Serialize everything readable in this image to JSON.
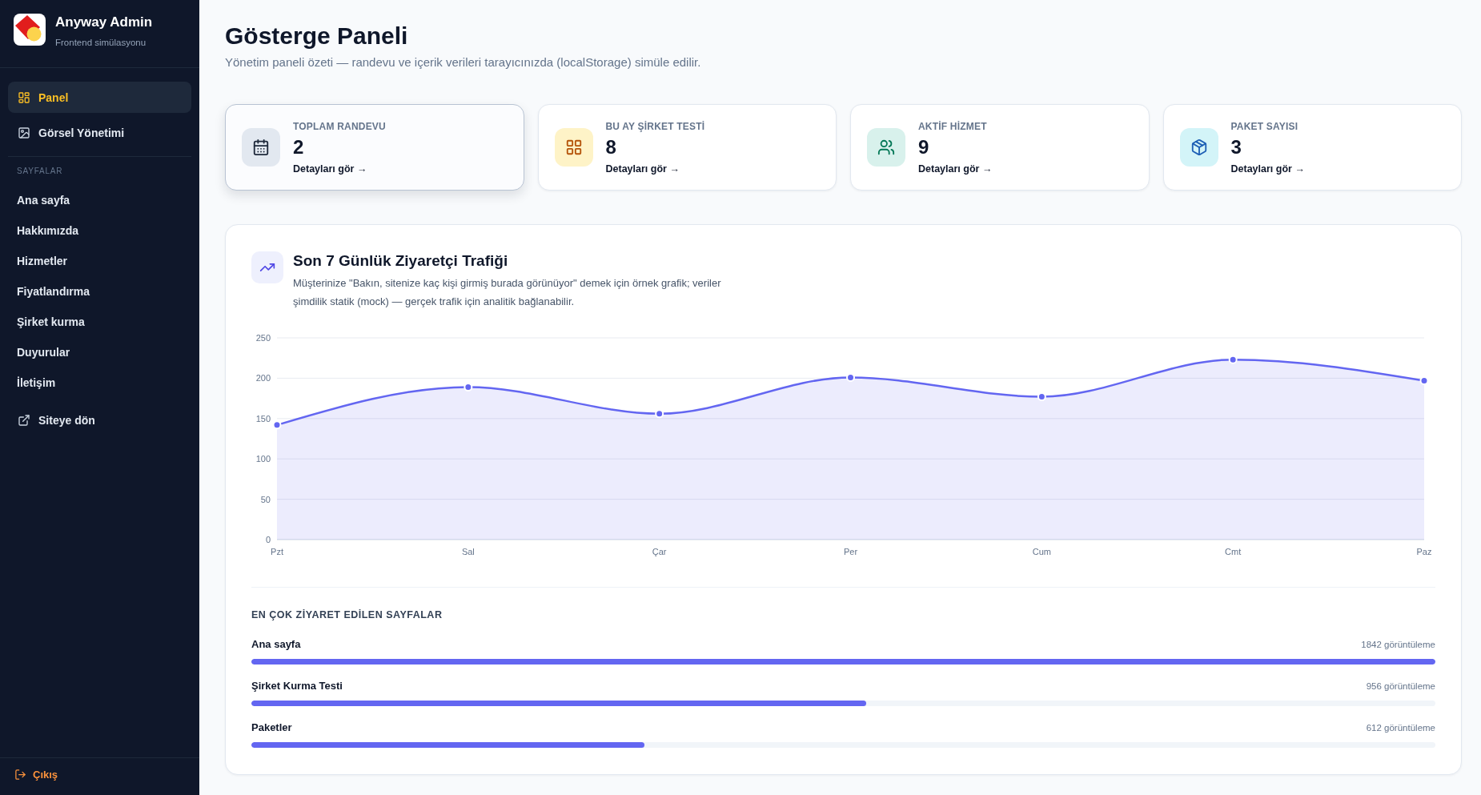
{
  "sidebar": {
    "brand": {
      "title": "Anyway Admin",
      "subtitle": "Frontend simülasyonu"
    },
    "main_items": [
      {
        "label": "Panel",
        "selected": true
      },
      {
        "label": "Görsel Yönetimi",
        "selected": false
      }
    ],
    "section": {
      "title": "SAYFALAR",
      "items": [
        {
          "label": "Ana sayfa",
          "selected": false
        },
        {
          "label": "Hakkımızda",
          "selected": false
        },
        {
          "label": "Hizmetler",
          "selected": false
        },
        {
          "label": "Fiyatlandırma",
          "selected": false
        },
        {
          "label": "Şirket kurma",
          "selected": false
        },
        {
          "label": "Duyurular",
          "selected": false
        },
        {
          "label": "İletişim",
          "selected": false
        }
      ]
    },
    "back_link": {
      "label": "Siteye dön"
    },
    "logout": {
      "label": "Çıkış"
    }
  },
  "header": {
    "title": "Gösterge Paneli",
    "subtitle": "Yönetim paneli özeti — randevu ve içerik verileri tarayıcınızda (localStorage) simüle edilir."
  },
  "stat_cards": [
    {
      "label": "TOPLAM RANDEVU",
      "value": "2",
      "link": "Detayları gör →",
      "hovered": true
    },
    {
      "label": "BU AY ŞİRKET TESTİ",
      "value": "8",
      "link": "Detayları gör →",
      "hovered": false
    },
    {
      "label": "AKTİF HİZMET",
      "value": "9",
      "link": "Detayları gör →",
      "hovered": false
    },
    {
      "label": "PAKET SAYISI",
      "value": "3",
      "link": "Detayları gör →",
      "hovered": false
    }
  ],
  "traffic": {
    "title": "Son 7 Günlük Ziyaretçi Trafiği",
    "description": "Müşterinize \"Bakın, sitenize kaç kişi girmiş burada görünüyor\" demek için örnek grafik; veriler şimdilik statik (mock) — gerçek trafik için analitik bağlanabilir.",
    "chart_data": {
      "type": "area",
      "categories": [
        "Pzt",
        "Sal",
        "Çar",
        "Per",
        "Cum",
        "Cmt",
        "Paz"
      ],
      "series": [
        {
          "color": "#6366f1",
          "values": [
            142,
            189,
            156,
            201,
            177,
            223,
            197
          ]
        }
      ],
      "ylim": [
        0,
        250
      ],
      "yticks": [
        0,
        50,
        100,
        150,
        200,
        250
      ],
      "grid": true
    }
  },
  "top_pages": {
    "title": "EN ÇOK ZİYARET EDİLEN SAYFALAR",
    "rows": [
      {
        "label": "Ana sayfa",
        "reading": "1842 görüntüleme",
        "level": 1.0
      },
      {
        "label": "Şirket Kurma Testi",
        "reading": "956 görüntüleme",
        "level": 0.519
      },
      {
        "label": "Paketler",
        "reading": "612 görüntüleme",
        "level": 0.332
      }
    ]
  }
}
